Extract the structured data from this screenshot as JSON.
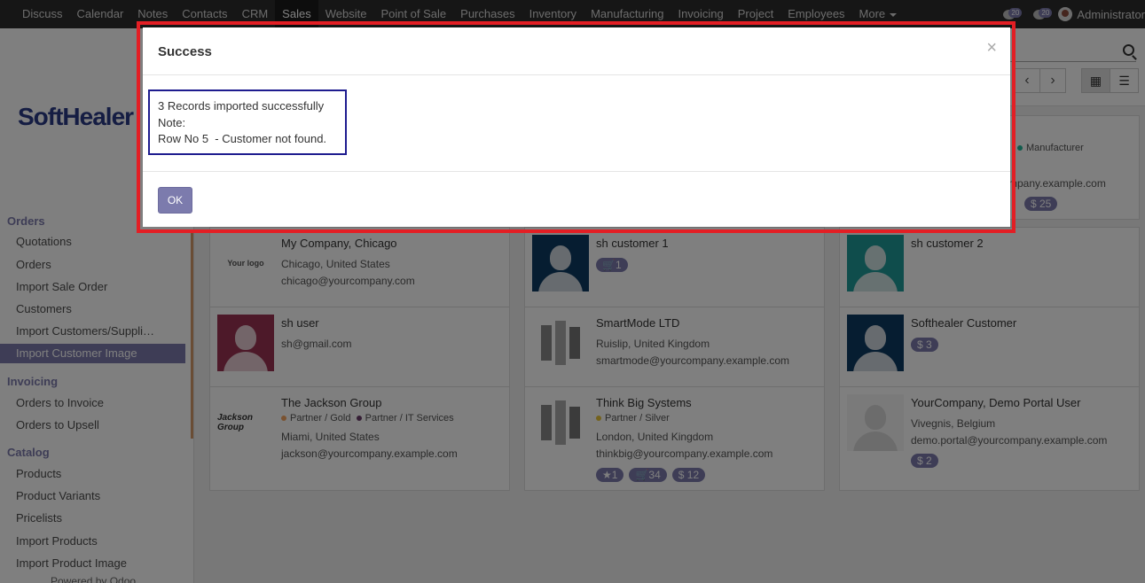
{
  "topbar": {
    "menu": [
      "Discuss",
      "Calendar",
      "Notes",
      "Contacts",
      "CRM",
      "Sales",
      "Website",
      "Point of Sale",
      "Purchases",
      "Inventory",
      "Manufacturing",
      "Invoicing",
      "Project",
      "Employees",
      "More"
    ],
    "active_menu": "Sales",
    "messages_count": "20",
    "activities_count": "20",
    "user": "Administrator"
  },
  "sidebar": {
    "logo_text": "SoftHealer",
    "sections": {
      "orders": "Orders",
      "invoicing": "Invoicing",
      "catalog": "Catalog"
    },
    "items": {
      "quotations": "Quotations",
      "orders": "Orders",
      "import_sale_order": "Import Sale Order",
      "customers": "Customers",
      "import_customers": "Import Customers/Suppli…",
      "import_customer_image": "Import Customer Image",
      "orders_to_invoice": "Orders to Invoice",
      "orders_to_upsell": "Orders to Upsell",
      "products": "Products",
      "product_variants": "Product Variants",
      "pricelists": "Pricelists",
      "import_products": "Import Products",
      "import_product_image": "Import Product Image"
    },
    "powered_by": "Powered by Odoo"
  },
  "cards": {
    "top_right": {
      "tag": "Manufacturer",
      "email": "mpany.example.com",
      "badge": "$ 25"
    },
    "c1": {
      "title": "My Company, Chicago",
      "logo": "Your logo",
      "line1": "Chicago, United States",
      "line2": "chicago@yourcompany.com"
    },
    "c2": {
      "title": "sh customer 1",
      "badge": "1"
    },
    "c3": {
      "title": "sh customer 2"
    },
    "c4": {
      "title": "sh user",
      "line1": "sh@gmail.com"
    },
    "c5": {
      "title": "SmartMode LTD",
      "line1": "Ruislip, United Kingdom",
      "line2": "smartmode@yourcompany.example.com"
    },
    "c6": {
      "title": "Softhealer Customer",
      "badge": "$ 3"
    },
    "c7": {
      "title": "The Jackson Group",
      "logo": "Jackson Group",
      "tag1": "Partner / Gold",
      "tag2": "Partner / IT Services",
      "line1": "Miami, United States",
      "line2": "jackson@yourcompany.example.com"
    },
    "c8": {
      "title": "Think Big Systems",
      "tag1": "Partner / Silver",
      "line1": "London, United Kingdom",
      "line2": "thinkbig@yourcompany.example.com",
      "badge1": "1",
      "badge2": "34",
      "badge3": "$ 12"
    },
    "c9": {
      "title": "YourCompany, Demo Portal User",
      "line1": "Vivegnis, Belgium",
      "line2": "demo.portal@yourcompany.example.com",
      "badge": "$ 2"
    }
  },
  "modal": {
    "title": "Success",
    "close": "×",
    "lines": [
      "3 Records imported successfully",
      "Note:",
      "Row No 5  - Customer not found."
    ],
    "ok_label": "OK"
  },
  "colors": {
    "accent": "#7c7bad",
    "highlight_frame": "#e31e24",
    "message_border": "#1e1c8f"
  }
}
